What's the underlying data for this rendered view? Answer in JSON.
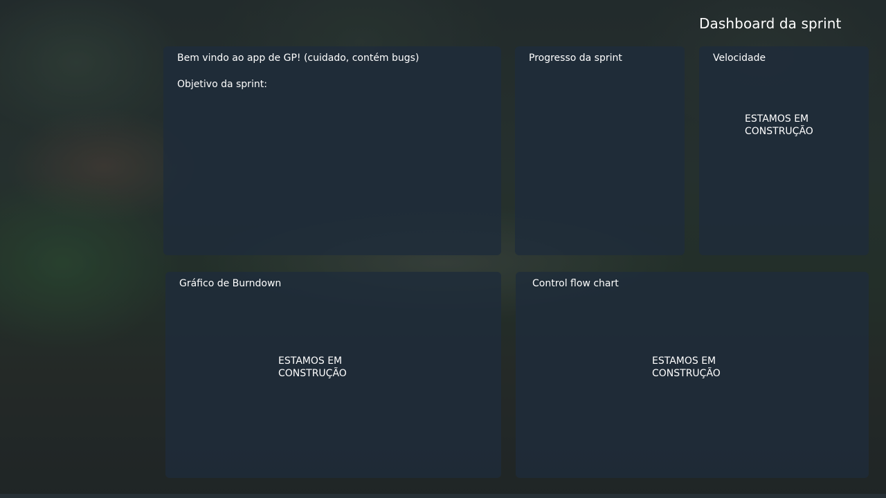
{
  "header": {
    "title": "Dashboard da sprint"
  },
  "tiles": {
    "welcome": {
      "title": "Bem vindo ao app de GP! (cuidado, contém bugs)",
      "subtitle": "Objetivo da sprint:"
    },
    "progress": {
      "title": "Progresso da sprint"
    },
    "velocity": {
      "title": "Velocidade",
      "status_line1": "ESTAMOS EM",
      "status_line2": "CONSTRUÇÃO"
    },
    "burndown": {
      "title": "Gráfico de Burndown",
      "status_line1": "ESTAMOS EM",
      "status_line2": "CONSTRUÇÃO"
    },
    "control_flow": {
      "title": "Control flow chart",
      "status_line1": "ESTAMOS EM",
      "status_line2": "CONSTRUÇÃO"
    }
  },
  "colors": {
    "tile_background": "#1e2c3a",
    "text": "#ffffff"
  }
}
